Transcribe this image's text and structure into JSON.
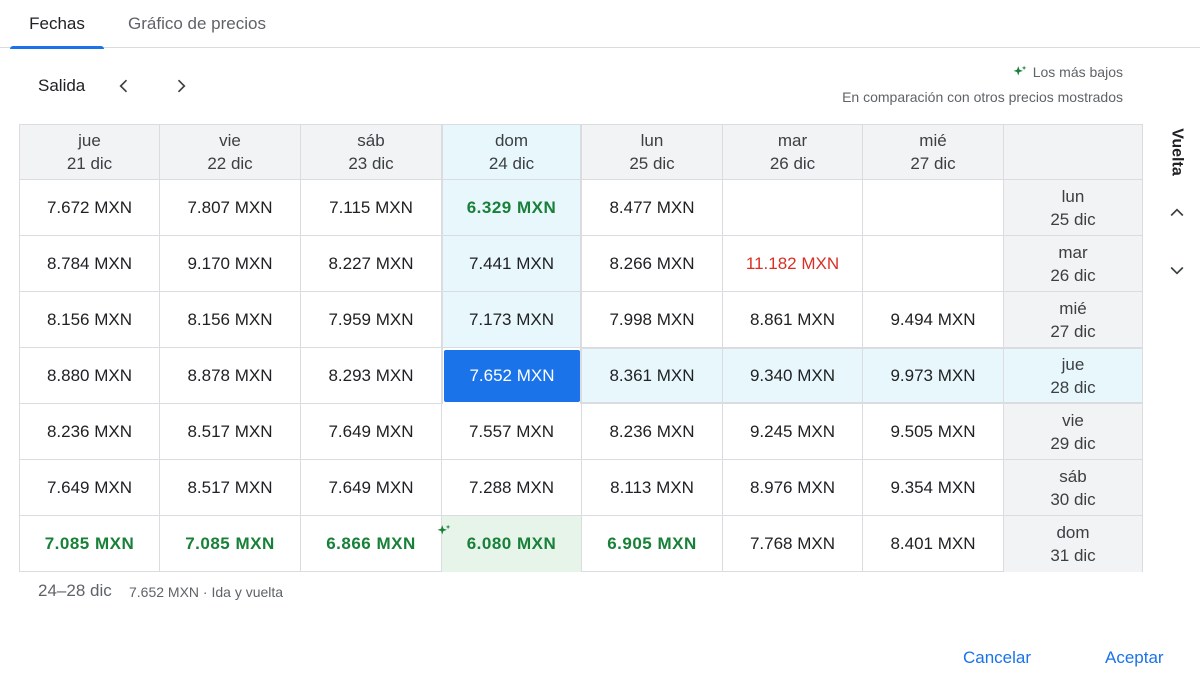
{
  "tabs": [
    {
      "label": "Fechas",
      "active": true
    },
    {
      "label": "Gráfico de precios",
      "active": false
    }
  ],
  "departure": {
    "label": "Salida"
  },
  "return": {
    "label": "Vuelta"
  },
  "legend": {
    "title": "Los más bajos",
    "subtitle": "En comparación con otros precios mostrados"
  },
  "columns": [
    {
      "day": "jue",
      "date": "21 dic"
    },
    {
      "day": "vie",
      "date": "22 dic"
    },
    {
      "day": "sáb",
      "date": "23 dic"
    },
    {
      "day": "dom",
      "date": "24 dic"
    },
    {
      "day": "lun",
      "date": "25 dic"
    },
    {
      "day": "mar",
      "date": "26 dic"
    },
    {
      "day": "mié",
      "date": "27 dic"
    }
  ],
  "rows": [
    {
      "day": "lun",
      "date": "25 dic",
      "prices": [
        "7.672 MXN",
        "7.807 MXN",
        "7.115 MXN",
        "6.329 MXN",
        "8.477 MXN",
        "",
        ""
      ]
    },
    {
      "day": "mar",
      "date": "26 dic",
      "prices": [
        "8.784 MXN",
        "9.170 MXN",
        "8.227 MXN",
        "7.441 MXN",
        "8.266 MXN",
        "11.182 MXN",
        ""
      ]
    },
    {
      "day": "mié",
      "date": "27 dic",
      "prices": [
        "8.156 MXN",
        "8.156 MXN",
        "7.959 MXN",
        "7.173 MXN",
        "7.998 MXN",
        "8.861 MXN",
        "9.494 MXN"
      ]
    },
    {
      "day": "jue",
      "date": "28 dic",
      "prices": [
        "8.880 MXN",
        "8.878 MXN",
        "8.293 MXN",
        "7.652 MXN",
        "8.361 MXN",
        "9.340 MXN",
        "9.973 MXN"
      ]
    },
    {
      "day": "vie",
      "date": "29 dic",
      "prices": [
        "8.236 MXN",
        "8.517 MXN",
        "7.649 MXN",
        "7.557 MXN",
        "8.236 MXN",
        "9.245 MXN",
        "9.505 MXN"
      ]
    },
    {
      "day": "sáb",
      "date": "30 dic",
      "prices": [
        "7.649 MXN",
        "8.517 MXN",
        "7.649 MXN",
        "7.288 MXN",
        "8.113 MXN",
        "8.976 MXN",
        "9.354 MXN"
      ]
    },
    {
      "day": "dom",
      "date": "31 dic",
      "prices": [
        "7.085 MXN",
        "7.085 MXN",
        "6.866 MXN",
        "6.080 MXN",
        "6.905 MXN",
        "7.768 MXN",
        "8.401 MXN"
      ]
    }
  ],
  "highlights": {
    "selected": {
      "row": 3,
      "col": 3
    },
    "lowest": [
      [
        0,
        3
      ],
      [
        6,
        0
      ],
      [
        6,
        1
      ],
      [
        6,
        2
      ],
      [
        6,
        3
      ],
      [
        6,
        4
      ]
    ],
    "lowest_overall": [
      6,
      3
    ],
    "highest": [
      [
        1,
        5
      ]
    ]
  },
  "colors": {
    "accent": "#1a73e8",
    "cheap": "#188038",
    "expensive": "#d93025",
    "selected_band": "#e8f7fc"
  },
  "footer": {
    "range": "24–28 dic",
    "price": "7.652 MXN · Ida y vuelta"
  },
  "actions": {
    "cancel": "Cancelar",
    "accept": "Aceptar"
  }
}
